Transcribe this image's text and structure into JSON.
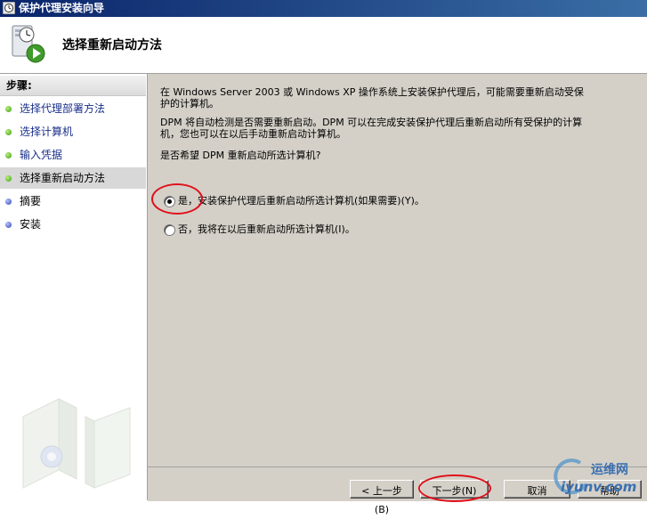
{
  "window": {
    "title": "保护代理安装向导"
  },
  "header": {
    "title": "选择重新启动方法"
  },
  "sidebar": {
    "heading": "步骤:",
    "items": [
      {
        "label": "选择代理部署方法",
        "state": "done"
      },
      {
        "label": "选择计算机",
        "state": "done"
      },
      {
        "label": "输入凭据",
        "state": "done"
      },
      {
        "label": "选择重新启动方法",
        "state": "active"
      },
      {
        "label": "摘要",
        "state": "todo"
      },
      {
        "label": "安装",
        "state": "todo"
      }
    ]
  },
  "main": {
    "intro_line1": "在 Windows Server 2003 或 Windows XP 操作系统上安装保护代理后，可能需要重新启动受保",
    "intro_line2": "护的计算机。",
    "detect_line1": "DPM 将自动检测是否需要重新启动。DPM 可以在完成安装保护代理后重新启动所有受保护的计算",
    "detect_line2": "机，您也可以在以后手动重新启动计算机。",
    "question": "是否希望 DPM 重新启动所选计算机?",
    "options": [
      {
        "label": "是，安装保护代理后重新启动所选计算机(如果需要)(Y)。",
        "selected": true
      },
      {
        "label": "否，我将在以后重新启动所选计算机(I)。",
        "selected": false
      }
    ]
  },
  "buttons": {
    "back": "< 上一步(B)",
    "next": "下一步(N)",
    "cancel": "取消",
    "help": "帮助"
  },
  "watermark": {
    "line1": "运维网",
    "line2": "iyunv.com"
  },
  "colors": {
    "annotation": "#e0101a",
    "dialog_bg": "#d4d0c8",
    "title_bar": "#0a246a"
  }
}
